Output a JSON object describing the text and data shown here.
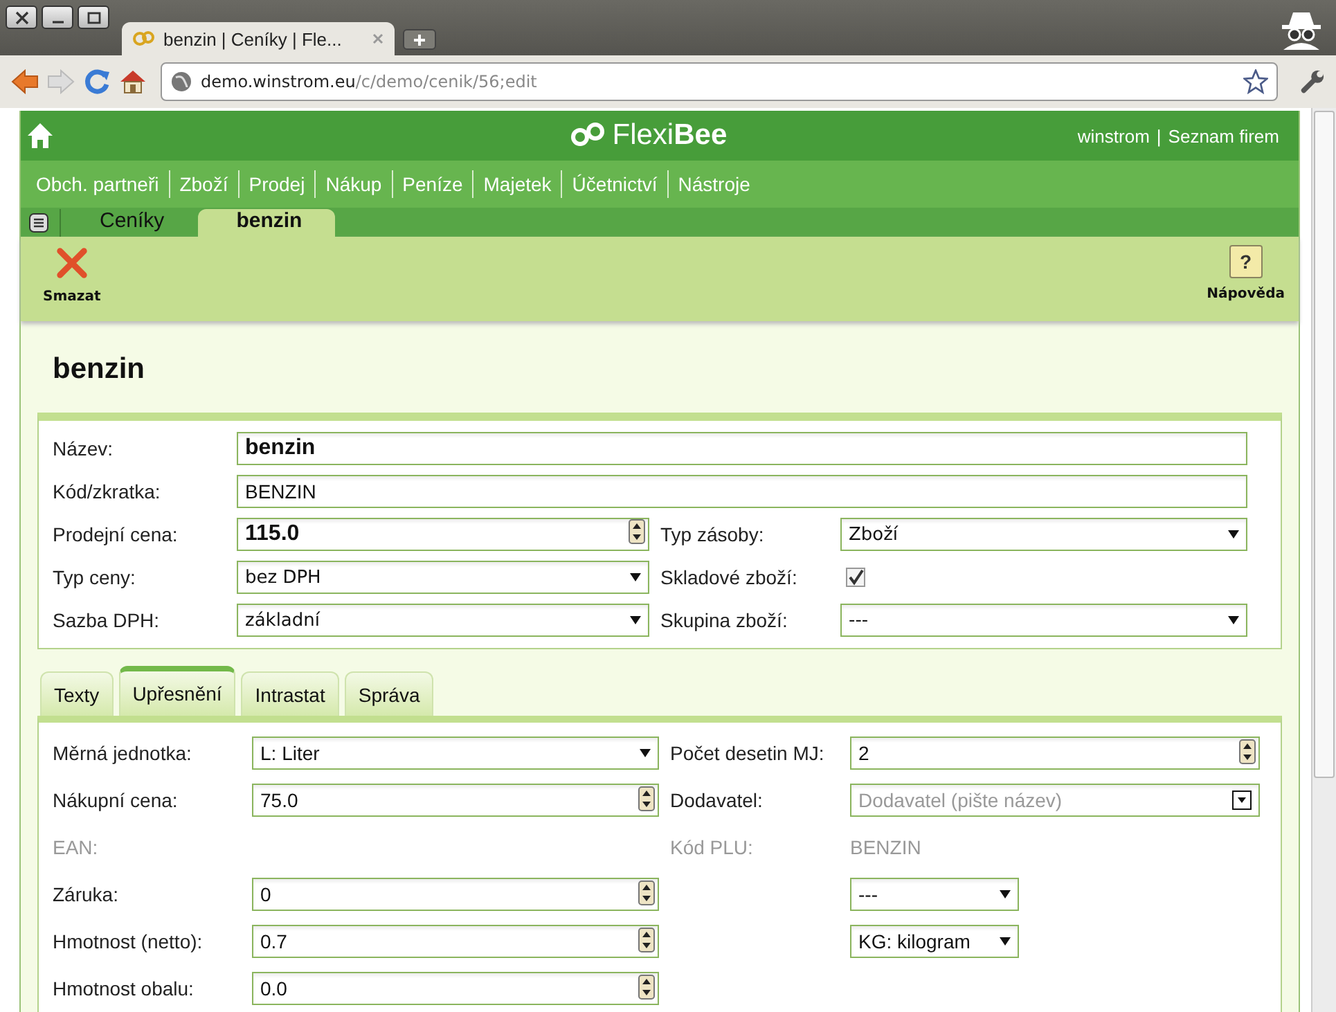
{
  "browser": {
    "tab": {
      "title": "benzin | Ceníky | Fle..."
    },
    "url": {
      "host": "demo.winstrom.eu",
      "path": "/c/demo/cenik/56;edit"
    }
  },
  "header": {
    "logo": "Flexi**Bee**",
    "user_links": [
      "winstrom",
      "Seznam firem"
    ],
    "separator": "|"
  },
  "nav": [
    "Obch. partneři",
    "Zboží",
    "Prodej",
    "Nákup",
    "Peníze",
    "Majetek",
    "Účetnictví",
    "Nástroje"
  ],
  "breadcrumbs": [
    {
      "label": "Ceníky",
      "selected": false
    },
    {
      "label": "benzin",
      "selected": true
    }
  ],
  "actions": [
    {
      "label": "Smazat",
      "kind": "delete"
    },
    {
      "label": "Nápověda",
      "kind": "help",
      "symbol": "?"
    }
  ],
  "record_title": "benzin",
  "main_form": [
    [
      {
        "label": "Název:",
        "kind": "text",
        "value": "benzin",
        "bold": true
      }
    ],
    [
      {
        "label": "Kód/zkratka:",
        "kind": "text",
        "value": "BENZIN",
        "bold": false
      }
    ],
    [
      {
        "label": "Prodejní cena:",
        "kind": "number",
        "value": "115.0",
        "bold": true
      },
      {
        "label": "Typ zásoby:",
        "kind": "select",
        "value": "Zboží"
      }
    ],
    [
      {
        "label": "Typ ceny:",
        "kind": "select",
        "value": "bez DPH"
      },
      {
        "label": "Skladové zboží:",
        "kind": "checkbox",
        "checked": true
      }
    ],
    [
      {
        "label": "Sazba DPH:",
        "kind": "select",
        "value": "základní"
      },
      {
        "label": "Skupina zboží:",
        "kind": "select",
        "value": "---"
      }
    ]
  ],
  "tabs": [
    {
      "label": "Texty",
      "selected": false
    },
    {
      "label": "Upřesnění",
      "selected": true
    },
    {
      "label": "Intrastat",
      "selected": false
    },
    {
      "label": "Správa",
      "selected": false
    }
  ],
  "detail_form": [
    [
      {
        "label": "Měrná jednotka:",
        "kind": "select",
        "value": "L: Liter"
      },
      {
        "label": "Počet desetin MJ:",
        "kind": "number",
        "value": "2"
      }
    ],
    [
      {
        "label": "Nákupní cena:",
        "kind": "number",
        "value": "75.0"
      },
      {
        "label": "Dodavatel:",
        "kind": "combo",
        "placeholder": "Dodavatel (pište název)"
      }
    ],
    [
      {
        "label": "EAN:",
        "kind": "empty",
        "disabled": true
      },
      {
        "label": "Kód PLU:",
        "kind": "static",
        "value": "BENZIN",
        "disabled": true
      }
    ],
    [
      {
        "label": "Záruka:",
        "kind": "number",
        "value": "0"
      },
      {
        "kind": "short-select",
        "value": "---"
      }
    ],
    [
      {
        "label": "Hmotnost (netto):",
        "kind": "number",
        "value": "0.7"
      },
      {
        "kind": "short-select",
        "value": "KG: kilogram"
      }
    ],
    [
      {
        "label": "Hmotnost obalu:",
        "kind": "number",
        "value": "0.0"
      }
    ]
  ]
}
